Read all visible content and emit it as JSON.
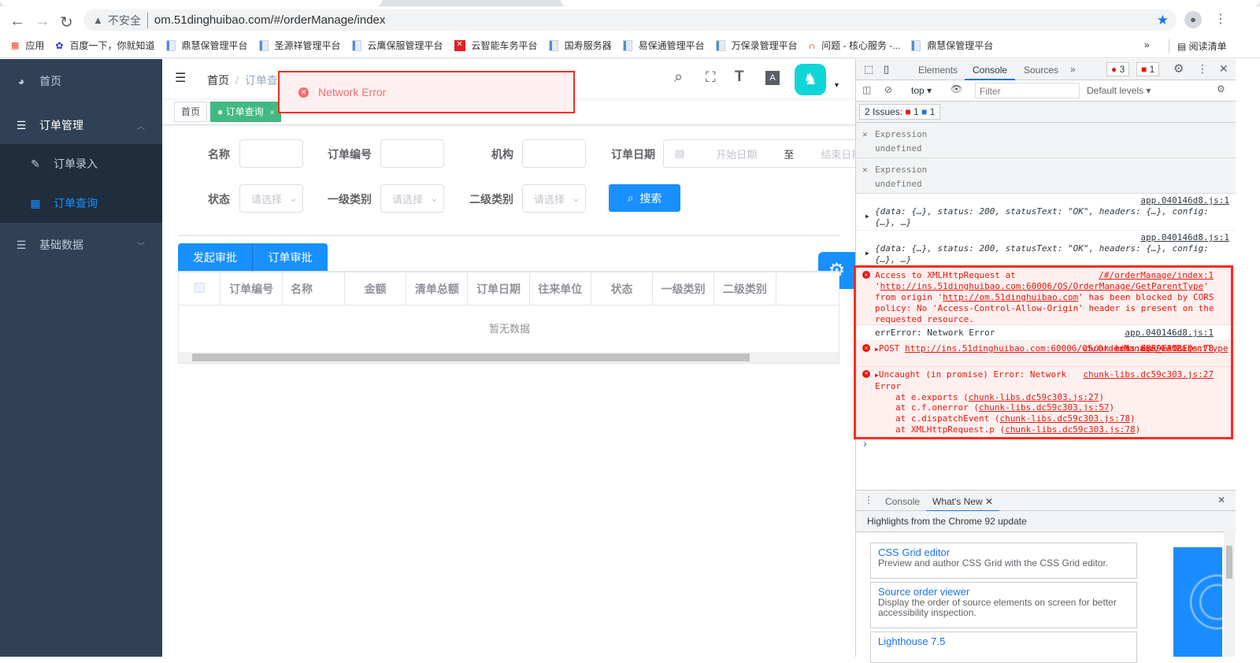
{
  "browser": {
    "url": "om.51dinghuibao.com/#/orderManage/index",
    "insecure_label": "不安全",
    "bookmarks": [
      "应用",
      "百度一下，你就知道",
      "鼎慧保管理平台",
      "圣源祥管理平台",
      "云鹰保服管理平台",
      "云智能车务平台",
      "国寿服务器",
      "易保通管理平台",
      "万保录管理平台",
      "问题 - 核心服务 -...",
      "鼎慧保管理平台"
    ],
    "reading_list": "阅读清单",
    "overflow": "»"
  },
  "sidebar": {
    "items": [
      {
        "label": "首页"
      },
      {
        "label": "订单管理"
      },
      {
        "label": "订单录入"
      },
      {
        "label": "订单查询"
      },
      {
        "label": "基础数据"
      }
    ]
  },
  "navbar": {
    "breadcrumb": [
      "首页",
      "订单查询"
    ]
  },
  "tags": [
    "首页",
    "订单查询"
  ],
  "toast": {
    "message": "Network Error"
  },
  "filters": {
    "name": "名称",
    "order_no": "订单编号",
    "org": "机构",
    "order_date": "订单日期",
    "start_placeholder": "开始日期",
    "to": "至",
    "end_placeholder": "结束日期",
    "status": "状态",
    "cat1": "一级类别",
    "cat2": "二级类别",
    "select_placeholder": "请选择",
    "search": "搜索"
  },
  "actions": {
    "start_approval": "发起审批",
    "order_approval": "订单审批"
  },
  "table": {
    "columns": [
      "订单编号",
      "名称",
      "金额",
      "清单总额",
      "订单日期",
      "往来单位",
      "状态",
      "一级类别",
      "二级类别"
    ],
    "empty": "暂无数据"
  },
  "devtools": {
    "tabs": [
      "Elements",
      "Console",
      "Sources"
    ],
    "active_tab": "Console",
    "more": "»",
    "error_count": "3",
    "issue_count": "1",
    "context": "top",
    "filter_placeholder": "Filter",
    "levels": "Default levels",
    "issues": {
      "label": "2 Issues:",
      "errors": "1",
      "info": "1"
    },
    "expressions": [
      {
        "label": "Expression",
        "value": "undefined"
      },
      {
        "label": "Expression",
        "value": "undefined"
      }
    ],
    "logs": [
      {
        "src": "app.040146d8.js:1",
        "text": "{data: {…}, status: 200, statusText: \"OK\", headers: {…}, config: {…}, …}"
      },
      {
        "src": "app.040146d8.js:1",
        "text": "{data: {…}, status: 200, statusText: \"OK\", headers: {…}, config: {…}, …}"
      }
    ],
    "cors": {
      "pre": "Access to XMLHttpRequest at '",
      "url": "http://ins.51dinghuibao.com:60006/OS/OrderManage/GetParentType",
      "mid": "' from origin '",
      "origin": "http://om.51dinghuibao.com",
      "post": "' has been blocked by CORS policy: No 'Access-Control-Allow-Origin' header is present on the requested resource.",
      "src": "/#/orderManage/index:1"
    },
    "err_log": {
      "text": "errError: Network Error",
      "src": "app.040146d8.js:1"
    },
    "post": {
      "method": "POST",
      "url": "http://ins.51dinghuibao.com:60006/OS/OrderManage/GetParentType",
      "status": "net::ERR_FAILED",
      "src": "chunk-libs.dc59c303.js:78"
    },
    "uncaught": {
      "text": "Uncaught (in promise) Error: Network Error",
      "src": "chunk-libs.dc59c303.js:27",
      "stack": [
        {
          "fn": "at e.exports",
          "loc": "chunk-libs.dc59c303.js:27"
        },
        {
          "fn": "at c.f.onerror",
          "loc": "chunk-libs.dc59c303.js:57"
        },
        {
          "fn": "at c.dispatchEvent",
          "loc": "chunk-libs.dc59c303.js:78"
        },
        {
          "fn": "at XMLHttpRequest.p",
          "loc": "chunk-libs.dc59c303.js:78"
        }
      ]
    },
    "prompt": "›",
    "drawer": {
      "tabs": [
        "Console",
        "What's New"
      ],
      "headline": "Highlights from the Chrome 92 update",
      "cards": [
        {
          "title": "CSS Grid editor",
          "desc": "Preview and author CSS Grid with the CSS Grid editor."
        },
        {
          "title": "Source order viewer",
          "desc": "Display the order of source elements on screen for better accessibility inspection."
        },
        {
          "title": "Lighthouse 7.5",
          "desc": ""
        }
      ]
    }
  }
}
